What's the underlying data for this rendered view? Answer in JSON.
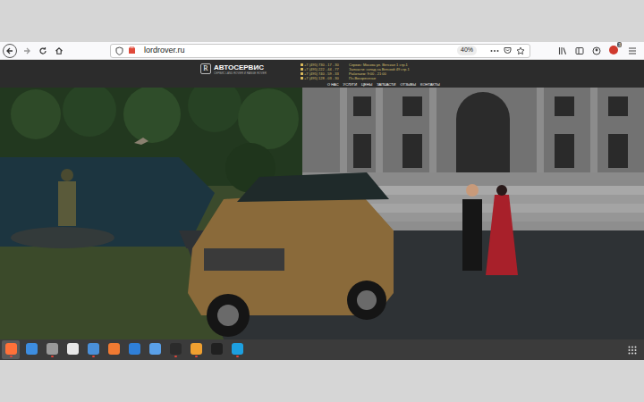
{
  "browser": {
    "url": "lordrover.ru",
    "zoom": "40%",
    "extension_badge": "3"
  },
  "site": {
    "logo": "R",
    "brand": "АВТОСЕРВИС",
    "tagline": "СЕРВИС LAND ROVER И RANGE ROVER",
    "phones": [
      "+7 (495) 730 - 17 - 30",
      "+7 (495) 222 - 44 - 77",
      "+7 (495) 740 - 59 - 33",
      "+7 (495) 128 - 03 - 30"
    ],
    "info": [
      "Сервис: Москва ул. Вятская 1 стр.1",
      "Запчасти: склад на Вятской 49 стр.1",
      "Работаем: 9:00 - 21:00",
      "Пн-Воскресенье"
    ],
    "nav": [
      "О НАС",
      "УСЛУГИ",
      "ЦЕНЫ",
      "ЗАПЧАСТИ",
      "ОТЗЫВЫ",
      "КОНТАКТЫ"
    ]
  },
  "taskbar": {
    "apps": [
      {
        "color": "#ff7139",
        "running": true,
        "selected": true
      },
      {
        "color": "#3d8de0",
        "running": false,
        "selected": false
      },
      {
        "color": "#9a9a9a",
        "running": true,
        "selected": false
      },
      {
        "color": "#e8e8e8",
        "running": false,
        "selected": false
      },
      {
        "color": "#4a90d9",
        "running": true,
        "selected": false
      },
      {
        "color": "#f07a32",
        "running": false,
        "selected": false
      },
      {
        "color": "#2f7fd8",
        "running": false,
        "selected": false
      },
      {
        "color": "#5aa0e8",
        "running": false,
        "selected": false
      },
      {
        "color": "#2b2b2b",
        "running": true,
        "selected": false
      },
      {
        "color": "#f0a030",
        "running": true,
        "selected": false
      },
      {
        "color": "#202020",
        "running": false,
        "selected": false
      },
      {
        "color": "#1da0e0",
        "running": true,
        "selected": false
      }
    ]
  }
}
